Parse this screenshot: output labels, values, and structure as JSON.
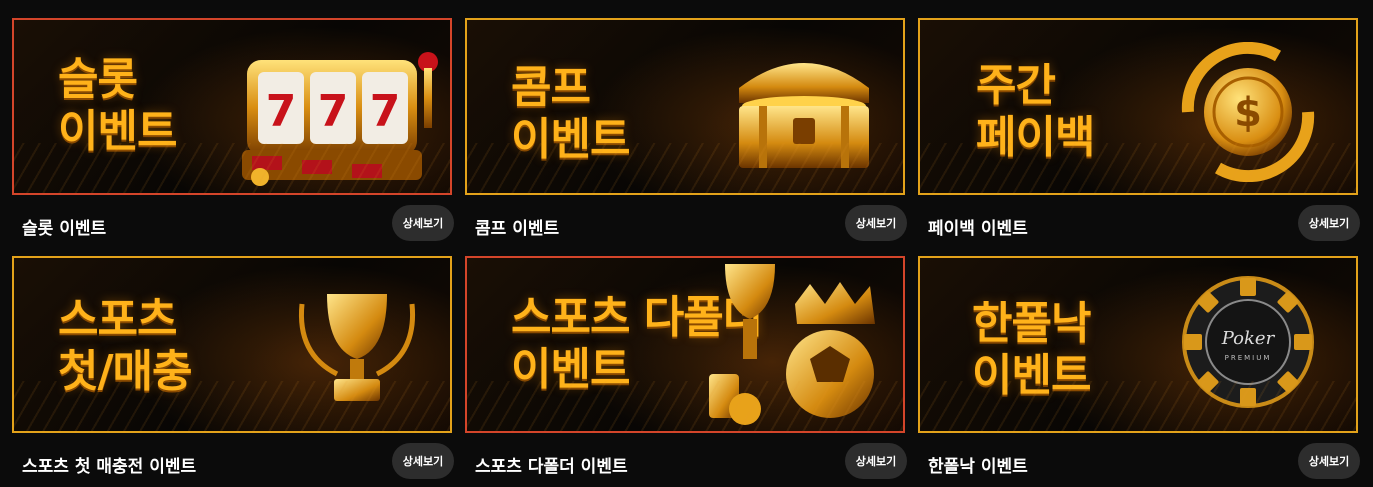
{
  "events": [
    {
      "title_lines": [
        "슬롯",
        "이벤트"
      ],
      "label": "슬롯 이벤트",
      "button": "상세보기",
      "art": "slot-machine-icon"
    },
    {
      "title_lines": [
        "콤프",
        "이벤트"
      ],
      "label": "콤프 이벤트",
      "button": "상세보기",
      "art": "treasure-chest-icon"
    },
    {
      "title_lines": [
        "주간",
        "페이백"
      ],
      "label": "페이백 이벤트",
      "button": "상세보기",
      "art": "dollar-coin-icon"
    },
    {
      "title_lines": [
        "스포츠",
        "첫/매충"
      ],
      "label": "스포츠 첫 매충전 이벤트",
      "button": "상세보기",
      "art": "trophy-icon"
    },
    {
      "title_lines": [
        "스포츠 다폴더",
        "이벤트"
      ],
      "label": "스포츠 다폴더 이벤트",
      "button": "상세보기",
      "art": "sports-ball-icon"
    },
    {
      "title_lines": [
        "한폴낙",
        "이벤트"
      ],
      "label": "한폴낙 이벤트",
      "button": "상세보기",
      "art": "poker-chip-icon"
    }
  ],
  "poker_chip_text": {
    "main": "Poker",
    "sub": "PREMIUM"
  },
  "colors": {
    "gold": "#ffb21a",
    "border": "#e3a21a",
    "button_bg": "#2d2d2d"
  }
}
